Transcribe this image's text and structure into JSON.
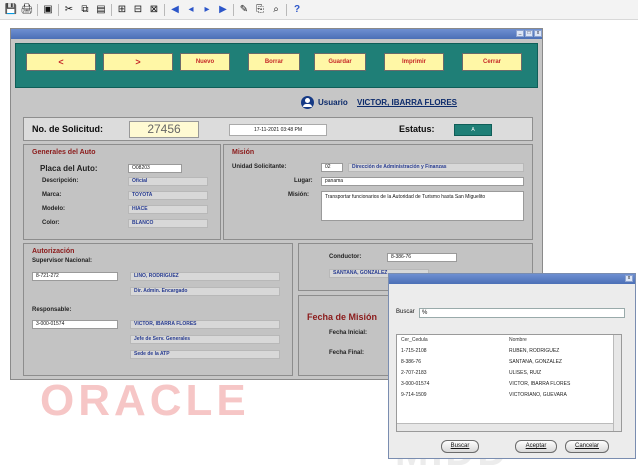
{
  "colors": {
    "nav_bg": "#1f7f77",
    "nav_button_bg": "#fff7a6",
    "nav_button_text": "#c62828",
    "section_title": "#8b1a1a",
    "value_text": "#283c91",
    "window_bg": "#c6c6c6"
  },
  "toolbar": {
    "help_label": "?",
    "icons": [
      "save-icon",
      "print-icon",
      "enter-query-icon",
      "cut-icon",
      "copy-icon",
      "paste-icon",
      "insert-record-icon",
      "remove-record-icon",
      "clear-record-icon",
      "first-record-icon",
      "previous-record-icon",
      "next-record-icon",
      "last-record-icon",
      "edit-icon",
      "attachment-icon",
      "query-icon",
      "help-icon"
    ]
  },
  "nav": {
    "prev": "<",
    "next": ">",
    "new": "Nuevo",
    "delete": "Borrar",
    "save": "Guardar",
    "print": "Imprimir",
    "close": "Cerrar"
  },
  "user": {
    "label": "Usuario",
    "name": "VICTOR, IBARRA FLORES"
  },
  "request": {
    "number_label": "No. de Solicitud:",
    "number": "27456",
    "datetime": "17-11-2021 03:48 PM",
    "status_label": "Estatus:",
    "status_value": "A"
  },
  "vehicle": {
    "title": "Generales del Auto",
    "plate_label": "Placa del Auto:",
    "plate": "O08203",
    "description_label": "Descripción:",
    "description": "Oficial",
    "brand_label": "Marca:",
    "brand": "TOYOTA",
    "model_label": "Modelo:",
    "model": "HIACE",
    "color_label": "Color:",
    "color": "BLANCO"
  },
  "mission": {
    "title": "Misión",
    "unit_label": "Unidad Solicitante:",
    "unit_code": "02",
    "unit_name": "Dirección de Administración y Finanzas",
    "place_label": "Lugar:",
    "place": "panama",
    "mission_label": "Misión:",
    "mission_text": "Transportar funcionarios de la Autoridad de Turismo hasta San Miguelito"
  },
  "authorization": {
    "title": "Autorización",
    "supervisor_label": "Supervisor Nacional:",
    "supervisor_id": "8-721-272",
    "supervisor_name": "LINO, RODRÍGUEZ",
    "supervisor_role": "Dir. Admin. Encargado",
    "responsible_label": "Responsable:",
    "responsible_id": "3-000-01574",
    "responsible_name": "VICTOR, IBARRA FLORES",
    "responsible_role": "Jefe de Serv. Generales",
    "responsible_site": "Sede de la ATP"
  },
  "driver": {
    "label": "Conductor:",
    "id": "8-386-76",
    "name": "SANTANA, GONZALEZ"
  },
  "mission_dates": {
    "title": "Fecha de Misión",
    "start_label": "Fecha Inicial:",
    "end_label": "Fecha Final:"
  },
  "watermark": {
    "text": "ORACLE",
    "text2": "MIDD"
  },
  "dialog": {
    "search_label": "Buscar",
    "search_value": "%",
    "columns": [
      "Cer_Cedula",
      "Nombre"
    ],
    "rows": [
      [
        "1-715-2108",
        "RUBEN, RODRIGUEZ"
      ],
      [
        "8-386-76",
        "SANTANA, GONZALEZ"
      ],
      [
        "2-707-2183",
        "ULISES, RUIZ"
      ],
      [
        "3-000-01574",
        "VICTOR, IBARRA FLORES"
      ],
      [
        "9-714-1509",
        "VICTORIANO, GUEVARA"
      ]
    ],
    "buttons": {
      "find": "Buscar",
      "accept": "Aceptar",
      "cancel": "Cancelar"
    }
  }
}
